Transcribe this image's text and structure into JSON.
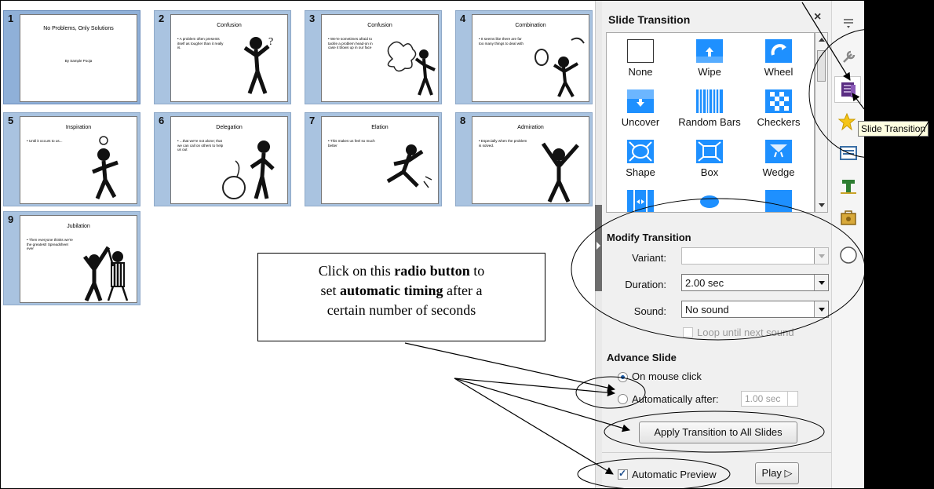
{
  "slides": [
    {
      "num": "1",
      "title": "No Problems, Only Solutions",
      "bullet": "",
      "byline": "By Sample Pooja"
    },
    {
      "num": "2",
      "title": "Confusion",
      "bullet": "• A problem often presents itself as tougher than it really is.",
      "byline": ""
    },
    {
      "num": "3",
      "title": "Confusion",
      "bullet": "• We're sometimes afraid to tackle a problem head-on in case it blows up in our face",
      "byline": ""
    },
    {
      "num": "4",
      "title": "Combination",
      "bullet": "• It seems like there are far too many things to deal with",
      "byline": ""
    },
    {
      "num": "5",
      "title": "Inspiration",
      "bullet": "• Until it occurs to us...",
      "byline": ""
    },
    {
      "num": "6",
      "title": "Delegation",
      "bullet": "• ...that we're not alone; that we can call on others to help us out",
      "byline": ""
    },
    {
      "num": "7",
      "title": "Elation",
      "bullet": "• This makes us feel so much better",
      "byline": ""
    },
    {
      "num": "8",
      "title": "Admiration",
      "bullet": "• Especially when the problem is solved.",
      "byline": ""
    },
    {
      "num": "9",
      "title": "Jubilation",
      "bullet": "• Then everyone thinks we're the greatest! Spreadsheet ever",
      "byline": ""
    }
  ],
  "panel": {
    "title": "Slide Transition",
    "close": "×",
    "transitions": [
      "None",
      "Wipe",
      "Wheel",
      "Uncover",
      "Random Bars",
      "Checkers",
      "Shape",
      "Box",
      "Wedge"
    ],
    "modify_heading": "Modify Transition",
    "variant_label": "Variant:",
    "variant_value": "",
    "duration_label": "Duration:",
    "duration_value": "2.00 sec",
    "sound_label": "Sound:",
    "sound_value": "No sound",
    "loop_label": "Loop until next sound",
    "advance_heading": "Advance Slide",
    "on_click_label": "On mouse click",
    "auto_label": "Automatically after:",
    "auto_value": "1.00 sec",
    "apply_all": "Apply Transition to All Slides",
    "auto_preview": "Automatic Preview",
    "play": "Play ▷"
  },
  "tooltip": "Slide Transition",
  "callout": {
    "line1_pre": "Click on this ",
    "line1_bold": "radio button",
    "line1_post": " to",
    "line2_pre": "set ",
    "line2_bold": "automatic timing",
    "line2_post": " after a",
    "line3": "certain number of seconds"
  },
  "colors": {
    "accent": "#1e90ff",
    "slide_frame": "#a9c3e0",
    "tooltip_bg": "#ffffe1"
  },
  "deck_icons": [
    "menu-icon",
    "properties-icon",
    "slide-transition-icon",
    "animation-icon",
    "master-slides-icon",
    "styles-icon",
    "gallery-icon",
    "navigator-icon"
  ]
}
